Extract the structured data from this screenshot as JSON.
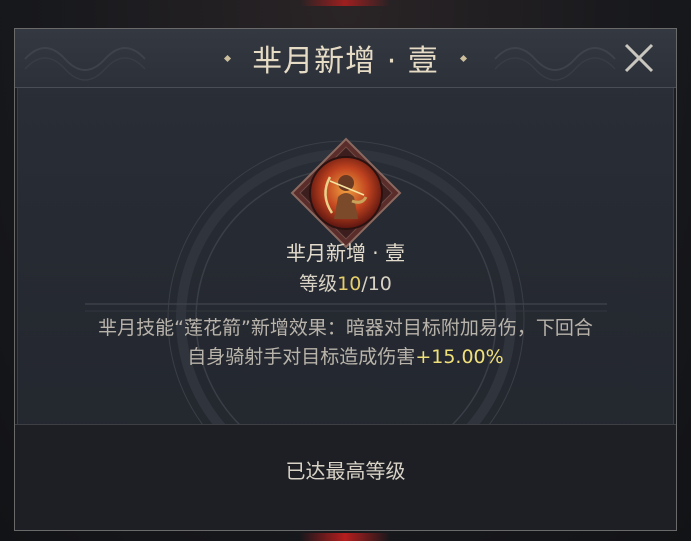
{
  "dialog": {
    "title": "芈月新增 · 壹",
    "close_icon": "close-icon",
    "accent_color": "#e6cf6a"
  },
  "skill": {
    "icon": "archer-portrait-icon",
    "name": "芈月新增 · 壹",
    "level_label": "等级",
    "level_current": "10",
    "level_max": "/10",
    "level_fraction": 1.0,
    "description_line1": "芈月技能“莲花箭”新增效果：暗器对目标附加易伤，下回合",
    "description_line2": "自身骑射手对目标造成伤害",
    "description_value": "+15.00%"
  },
  "footer": {
    "status": "已达最高等级"
  }
}
